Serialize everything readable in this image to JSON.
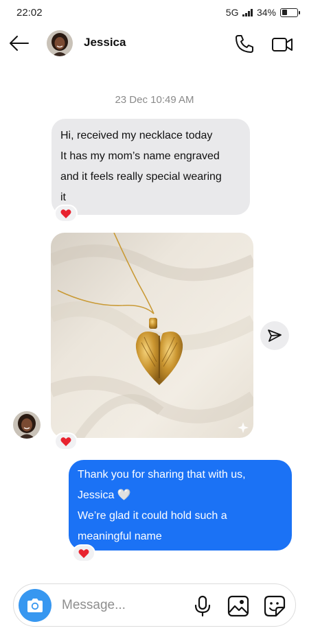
{
  "status_bar": {
    "time": "22:02",
    "network": "5G",
    "battery_percent": "34%",
    "battery_level": 0.34,
    "signal_bars": 4
  },
  "header": {
    "back_icon": "arrow-left-icon",
    "contact_name": "Jessica",
    "call_icon": "phone-icon",
    "video_icon": "video-camera-icon"
  },
  "chat": {
    "timestamp": "23 Dec 10:49 AM",
    "messages": [
      {
        "direction": "incoming",
        "lines": [
          "Hi, received my necklace today",
          "It has my mom’s name engraved",
          "and it feels really special wearing",
          "it"
        ],
        "reaction": "❤️"
      },
      {
        "direction": "incoming",
        "type": "image",
        "image_subject": "gold heart-shaped angel wings pendant necklace on cream fleece",
        "reaction": "❤️",
        "share_icon": "paper-plane-icon"
      },
      {
        "direction": "outgoing",
        "lines": [
          "Thank you for sharing that with us,",
          "Jessica 🤍",
          "We’re glad it could hold such a",
          "meaningful name"
        ],
        "reaction": "❤️"
      }
    ]
  },
  "composer": {
    "placeholder": "Message...",
    "camera_icon": "camera-icon",
    "mic_icon": "microphone-icon",
    "gallery_icon": "image-gallery-icon",
    "sticker_icon": "sticker-icon"
  },
  "colors": {
    "outgoing_bubble": "#1b72f5",
    "incoming_bubble": "#e9e9eb",
    "camera_button": "#3797f0",
    "timestamp_text": "#8a8a8a"
  }
}
